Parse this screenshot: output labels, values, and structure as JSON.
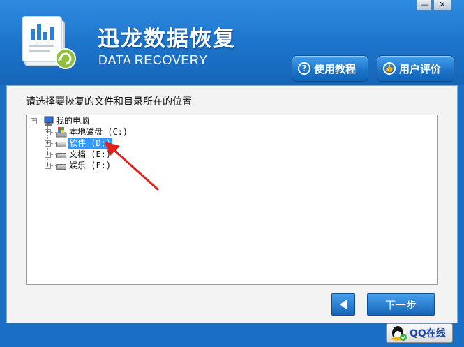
{
  "window": {
    "minimize_glyph": "—",
    "close_glyph": "✕"
  },
  "brand": {
    "title_cn": "迅龙数据恢复",
    "title_en": "DATA RECOVERY"
  },
  "header_buttons": {
    "tutorial": "使用教程",
    "reviews": "用户评价"
  },
  "main": {
    "prompt": "请选择要恢复的文件和目录所在的位置"
  },
  "tree": {
    "root": "我的电脑",
    "items": [
      {
        "label": "本地磁盘 (C:)",
        "icon": "windows-drive-icon"
      },
      {
        "label": "软件 (D:)",
        "icon": "drive-icon",
        "selected": true
      },
      {
        "label": "文档 (E:)",
        "icon": "drive-icon"
      },
      {
        "label": "娱乐 (F:)",
        "icon": "drive-icon"
      }
    ]
  },
  "footer": {
    "next_label": "下一步",
    "qq_label": "QQ在线"
  },
  "colors": {
    "header_blue": "#1c73c9",
    "selection": "#3399ff",
    "arrow_red": "#e0201b"
  }
}
